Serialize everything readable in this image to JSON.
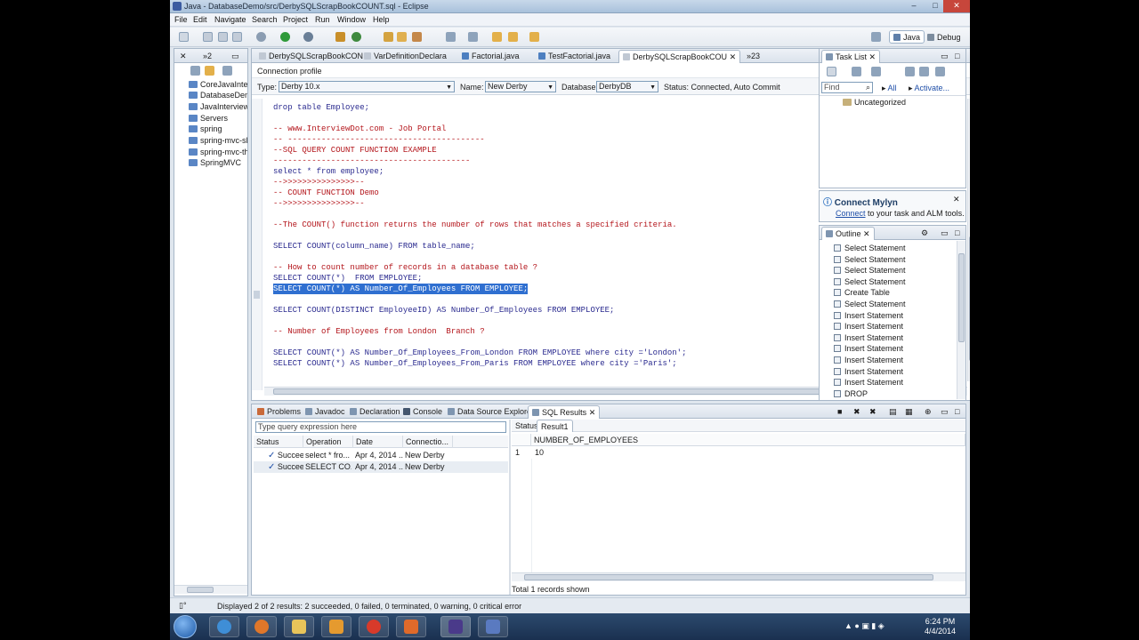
{
  "window": {
    "title": "Java - DatabaseDemo/src/DerbySQLScrapBookCOUNT.sql - Eclipse",
    "minimize": "–",
    "maximize": "□",
    "close": "✕"
  },
  "menu": [
    "File",
    "Edit",
    "Navigate",
    "Search",
    "Project",
    "Run",
    "Window",
    "Help"
  ],
  "perspectives": {
    "java": "Java",
    "debug": "Debug"
  },
  "package_explorer": {
    "overflow_label": "»2",
    "items": [
      "CoreJavaInter",
      "DatabaseDem",
      "JavaInterview-",
      "Servers",
      "spring",
      "spring-mvc-sl",
      "spring-mvc-th",
      "SpringMVC"
    ]
  },
  "editor": {
    "tabs": [
      "DerbySQLScrapBookCON",
      "VarDefinitionDeclara",
      "Factorial.java",
      "TestFactorial.java",
      "DerbySQLScrapBookCOU"
    ],
    "overflow_label": "»23",
    "connection": {
      "heading": "Connection profile",
      "type_label": "Type:",
      "type_value": "Derby 10.x",
      "name_label": "Name:",
      "name_value": "New Derby",
      "database_label": "Database:",
      "database_value": "DerbyDB",
      "status": "Status: Connected, Auto Commit"
    },
    "lines": [
      {
        "text": "drop table Employee;",
        "style": "blue"
      },
      {
        "text": "",
        "style": "blue"
      },
      {
        "text": "-- www.InterviewDot.com - Job Portal",
        "style": "red"
      },
      {
        "text": "-- -----------------------------------------",
        "style": "red"
      },
      {
        "text": "--SQL QUERY COUNT FUNCTION EXAMPLE",
        "style": "red"
      },
      {
        "text": "-----------------------------------------",
        "style": "red"
      },
      {
        "text": "select * from employee;",
        "style": "blue"
      },
      {
        "text": "-->>>>>>>>>>>>>>>--",
        "style": "red"
      },
      {
        "text": "-- COUNT FUNCTION Demo",
        "style": "red"
      },
      {
        "text": "-->>>>>>>>>>>>>>>--",
        "style": "red"
      },
      {
        "text": "",
        "style": "blue"
      },
      {
        "text": "--The COUNT() function returns the number of rows that matches a specified criteria.",
        "style": "red"
      },
      {
        "text": "",
        "style": "blue"
      },
      {
        "text": "SELECT COUNT(column_name) FROM table_name;",
        "style": "blue"
      },
      {
        "text": "",
        "style": "blue"
      },
      {
        "text": "-- How to count number of records in a database table ?",
        "style": "red"
      },
      {
        "text": "SELECT COUNT(*)  FROM EMPLOYEE;",
        "style": "blue"
      },
      {
        "text": "SELECT COUNT(*) AS Number_Of_Employees FROM EMPLOYEE;",
        "style": "sel"
      },
      {
        "text": "",
        "style": "blue"
      },
      {
        "text": "SELECT COUNT(DISTINCT EmployeeID) AS Number_Of_Employees FROM EMPLOYEE;",
        "style": "blue"
      },
      {
        "text": "",
        "style": "blue"
      },
      {
        "text": "-- Number of Employees from London  Branch ?",
        "style": "red"
      },
      {
        "text": "",
        "style": "blue"
      },
      {
        "text": "SELECT COUNT(*) AS Number_Of_Employees_From_London FROM EMPLOYEE where city ='London';",
        "style": "blue"
      },
      {
        "text": "SELECT COUNT(*) AS Number_Of_Employees_From_Paris FROM EMPLOYEE where city ='Paris';",
        "style": "blue"
      }
    ]
  },
  "task_list": {
    "tab": "Task List",
    "find_placeholder": "Find",
    "all": "All",
    "activate": "Activate...",
    "uncategorized": "Uncategorized"
  },
  "mylyn": {
    "title": "Connect Mylyn",
    "link": "Connect",
    "text": " to your task and ALM tools."
  },
  "outline": {
    "tab": "Outline",
    "items": [
      "Select Statement",
      "Select Statement",
      "Select Statement",
      "Select Statement",
      "Create Table",
      "Select Statement",
      "Insert Statement",
      "Insert Statement",
      "Insert Statement",
      "Insert Statement",
      "Insert Statement",
      "Insert Statement",
      "Insert Statement",
      "DROP"
    ]
  },
  "bottom": {
    "tabs": [
      "Problems",
      "Javadoc",
      "Declaration",
      "Console",
      "Data Source Explorer",
      "SQL Results"
    ],
    "query_placeholder": "Type query expression here",
    "history_headers": [
      "Status",
      "Operation",
      "Date",
      "Connectio..."
    ],
    "history_rows": [
      {
        "status": "Succee",
        "operation": "select * fro...",
        "date": "Apr 4, 2014 ...",
        "connection": "New Derby"
      },
      {
        "status": "Succee",
        "operation": "SELECT CO...",
        "date": "Apr 4, 2014 ...",
        "connection": "New Derby"
      }
    ],
    "result_tabs": [
      "Status",
      "Result1"
    ],
    "result_column": "NUMBER_OF_EMPLOYEES",
    "result_rows": [
      {
        "index": "1",
        "value": "10"
      }
    ],
    "total": "Total 1 records shown"
  },
  "status_bar": {
    "text": "Displayed 2 of 2 results: 2 succeeded, 0 failed, 0 terminated, 0 warning, 0 critical error"
  },
  "taskbar": {
    "time": "6:24 PM",
    "date": "4/4/2014"
  },
  "colors": {
    "keyword": "#2a2a8f",
    "comment": "#b4161c",
    "selection": "#2f6fd0",
    "taskbar": "#1a3050"
  }
}
